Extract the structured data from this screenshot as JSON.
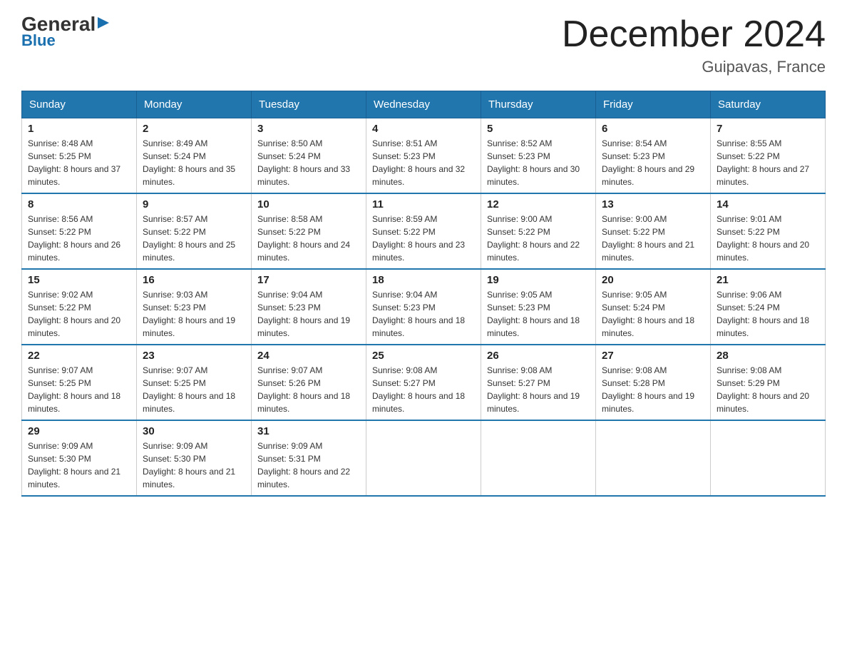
{
  "header": {
    "logo_general": "General",
    "logo_blue": "Blue",
    "month_title": "December 2024",
    "location": "Guipavas, France"
  },
  "days_of_week": [
    "Sunday",
    "Monday",
    "Tuesday",
    "Wednesday",
    "Thursday",
    "Friday",
    "Saturday"
  ],
  "weeks": [
    [
      {
        "day": "1",
        "sunrise": "8:48 AM",
        "sunset": "5:25 PM",
        "daylight": "8 hours and 37 minutes."
      },
      {
        "day": "2",
        "sunrise": "8:49 AM",
        "sunset": "5:24 PM",
        "daylight": "8 hours and 35 minutes."
      },
      {
        "day": "3",
        "sunrise": "8:50 AM",
        "sunset": "5:24 PM",
        "daylight": "8 hours and 33 minutes."
      },
      {
        "day": "4",
        "sunrise": "8:51 AM",
        "sunset": "5:23 PM",
        "daylight": "8 hours and 32 minutes."
      },
      {
        "day": "5",
        "sunrise": "8:52 AM",
        "sunset": "5:23 PM",
        "daylight": "8 hours and 30 minutes."
      },
      {
        "day": "6",
        "sunrise": "8:54 AM",
        "sunset": "5:23 PM",
        "daylight": "8 hours and 29 minutes."
      },
      {
        "day": "7",
        "sunrise": "8:55 AM",
        "sunset": "5:22 PM",
        "daylight": "8 hours and 27 minutes."
      }
    ],
    [
      {
        "day": "8",
        "sunrise": "8:56 AM",
        "sunset": "5:22 PM",
        "daylight": "8 hours and 26 minutes."
      },
      {
        "day": "9",
        "sunrise": "8:57 AM",
        "sunset": "5:22 PM",
        "daylight": "8 hours and 25 minutes."
      },
      {
        "day": "10",
        "sunrise": "8:58 AM",
        "sunset": "5:22 PM",
        "daylight": "8 hours and 24 minutes."
      },
      {
        "day": "11",
        "sunrise": "8:59 AM",
        "sunset": "5:22 PM",
        "daylight": "8 hours and 23 minutes."
      },
      {
        "day": "12",
        "sunrise": "9:00 AM",
        "sunset": "5:22 PM",
        "daylight": "8 hours and 22 minutes."
      },
      {
        "day": "13",
        "sunrise": "9:00 AM",
        "sunset": "5:22 PM",
        "daylight": "8 hours and 21 minutes."
      },
      {
        "day": "14",
        "sunrise": "9:01 AM",
        "sunset": "5:22 PM",
        "daylight": "8 hours and 20 minutes."
      }
    ],
    [
      {
        "day": "15",
        "sunrise": "9:02 AM",
        "sunset": "5:22 PM",
        "daylight": "8 hours and 20 minutes."
      },
      {
        "day": "16",
        "sunrise": "9:03 AM",
        "sunset": "5:23 PM",
        "daylight": "8 hours and 19 minutes."
      },
      {
        "day": "17",
        "sunrise": "9:04 AM",
        "sunset": "5:23 PM",
        "daylight": "8 hours and 19 minutes."
      },
      {
        "day": "18",
        "sunrise": "9:04 AM",
        "sunset": "5:23 PM",
        "daylight": "8 hours and 18 minutes."
      },
      {
        "day": "19",
        "sunrise": "9:05 AM",
        "sunset": "5:23 PM",
        "daylight": "8 hours and 18 minutes."
      },
      {
        "day": "20",
        "sunrise": "9:05 AM",
        "sunset": "5:24 PM",
        "daylight": "8 hours and 18 minutes."
      },
      {
        "day": "21",
        "sunrise": "9:06 AM",
        "sunset": "5:24 PM",
        "daylight": "8 hours and 18 minutes."
      }
    ],
    [
      {
        "day": "22",
        "sunrise": "9:07 AM",
        "sunset": "5:25 PM",
        "daylight": "8 hours and 18 minutes."
      },
      {
        "day": "23",
        "sunrise": "9:07 AM",
        "sunset": "5:25 PM",
        "daylight": "8 hours and 18 minutes."
      },
      {
        "day": "24",
        "sunrise": "9:07 AM",
        "sunset": "5:26 PM",
        "daylight": "8 hours and 18 minutes."
      },
      {
        "day": "25",
        "sunrise": "9:08 AM",
        "sunset": "5:27 PM",
        "daylight": "8 hours and 18 minutes."
      },
      {
        "day": "26",
        "sunrise": "9:08 AM",
        "sunset": "5:27 PM",
        "daylight": "8 hours and 19 minutes."
      },
      {
        "day": "27",
        "sunrise": "9:08 AM",
        "sunset": "5:28 PM",
        "daylight": "8 hours and 19 minutes."
      },
      {
        "day": "28",
        "sunrise": "9:08 AM",
        "sunset": "5:29 PM",
        "daylight": "8 hours and 20 minutes."
      }
    ],
    [
      {
        "day": "29",
        "sunrise": "9:09 AM",
        "sunset": "5:30 PM",
        "daylight": "8 hours and 21 minutes."
      },
      {
        "day": "30",
        "sunrise": "9:09 AM",
        "sunset": "5:30 PM",
        "daylight": "8 hours and 21 minutes."
      },
      {
        "day": "31",
        "sunrise": "9:09 AM",
        "sunset": "5:31 PM",
        "daylight": "8 hours and 22 minutes."
      },
      null,
      null,
      null,
      null
    ]
  ],
  "labels": {
    "sunrise": "Sunrise:",
    "sunset": "Sunset:",
    "daylight": "Daylight:"
  }
}
